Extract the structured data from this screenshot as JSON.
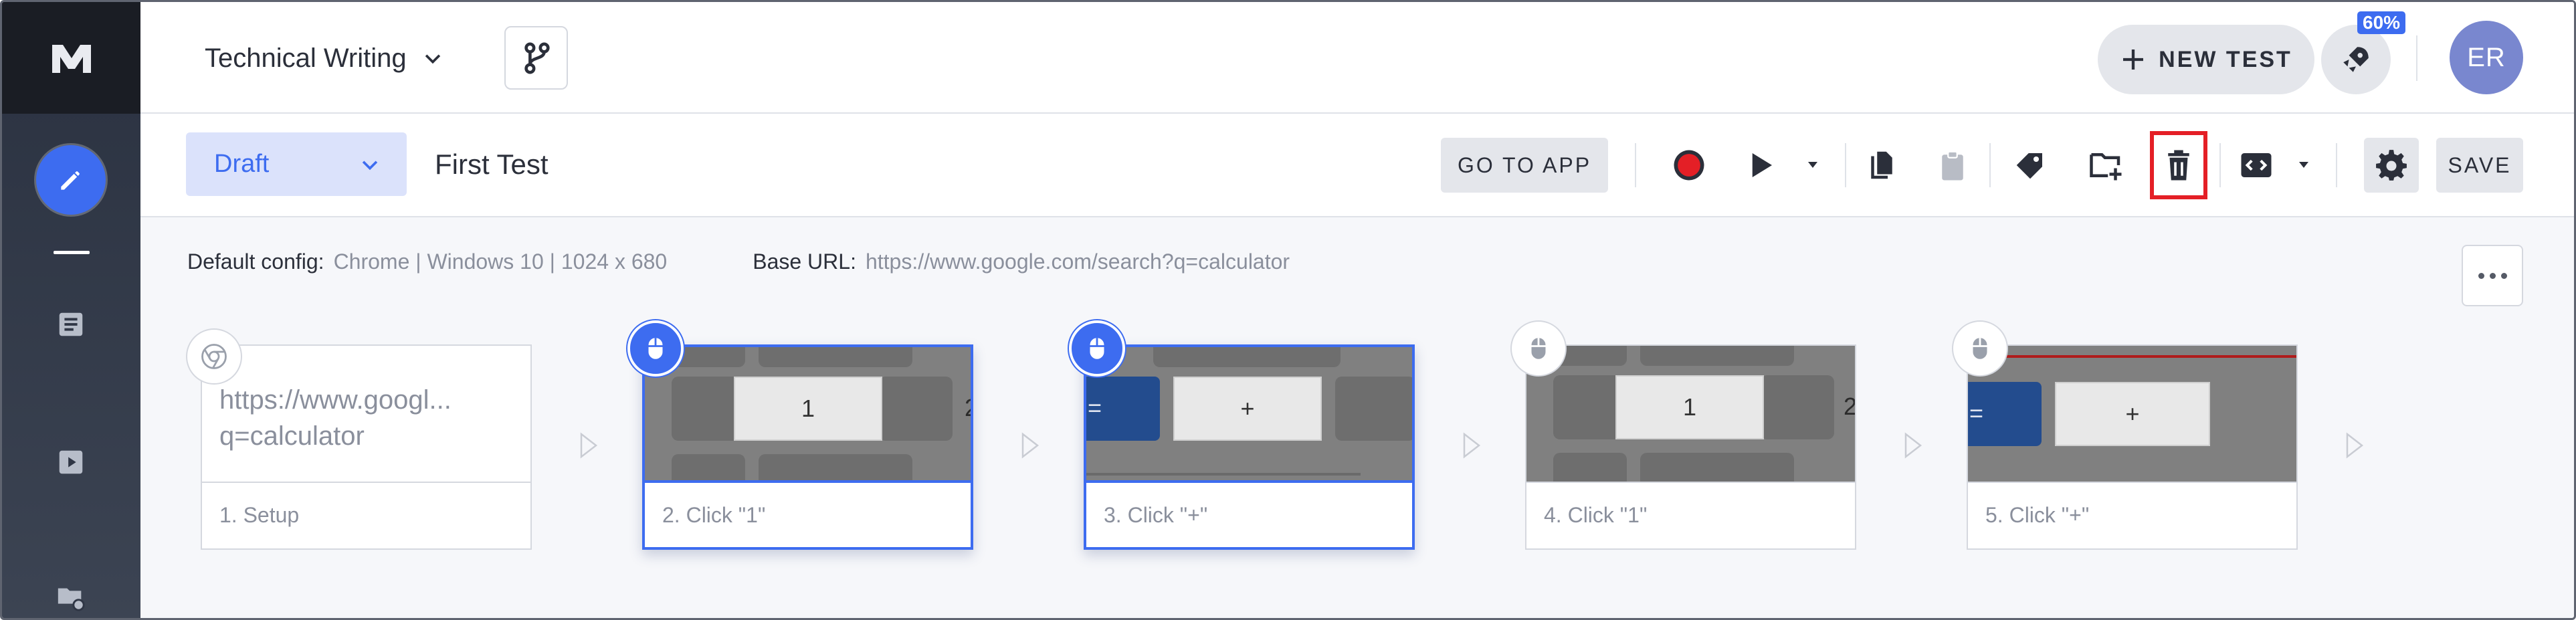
{
  "app": {
    "logo": "M"
  },
  "nav": {
    "items": [
      {
        "name": "edit-icon",
        "active": true
      },
      {
        "name": "list-icon"
      },
      {
        "name": "play-square-icon"
      },
      {
        "name": "folder-settings-icon"
      }
    ]
  },
  "header": {
    "project": "Technical Writing",
    "new_test_label": "NEW TEST",
    "notification_badge": "60%",
    "avatar_initials": "ER"
  },
  "toolbar": {
    "status": "Draft",
    "test_name": "First Test",
    "goto_app_label": "GO TO APP",
    "save_label": "SAVE",
    "icons": [
      "record-icon",
      "play-icon",
      "copy-icon",
      "paste-icon",
      "tag-icon",
      "folder-add-icon",
      "trash-icon",
      "code-icon",
      "gear-icon"
    ],
    "highlighted": "trash-icon"
  },
  "config": {
    "default_config_label": "Default config:",
    "default_config_value": "Chrome | Windows 10 | 1024 x 680",
    "base_url_label": "Base URL:",
    "base_url_value": "https://www.google.com/search?q=calculator"
  },
  "steps": [
    {
      "caption": "1. Setup",
      "url_line1": "https://www.googl...",
      "url_line2": "q=calculator",
      "icon": "chrome-icon",
      "selected": false
    },
    {
      "caption": "2. Click \"1\"",
      "key": "1",
      "edge": "2",
      "icon": "mouse-icon",
      "selected": true
    },
    {
      "caption": "3. Click \"+\"",
      "key": "+",
      "edge": "=",
      "icon": "mouse-icon",
      "selected": true
    },
    {
      "caption": "4. Click \"1\"",
      "key": "1",
      "edge": "2",
      "icon": "mouse-icon",
      "selected": false
    },
    {
      "caption": "5. Click \"+\"",
      "key": "+",
      "edge": "=",
      "icon": "mouse-icon",
      "selected": false
    }
  ],
  "colors": {
    "accent": "#3d6cf0",
    "highlight": "#e41f26",
    "nav_bg": "#2a3140",
    "record": "#e41f26"
  }
}
